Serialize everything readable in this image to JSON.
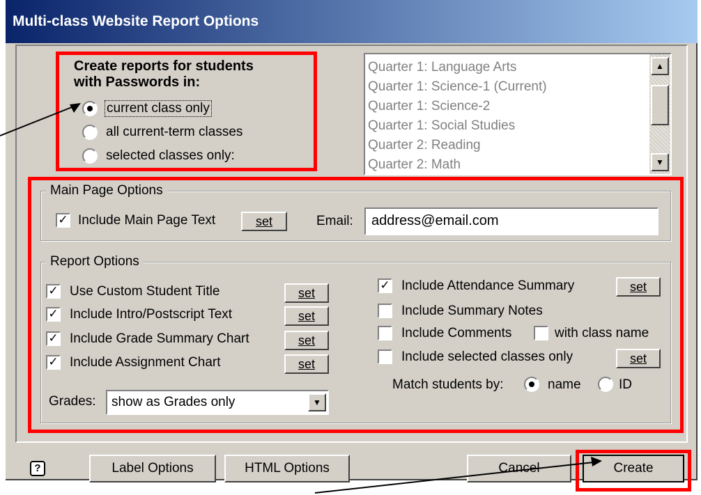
{
  "window": {
    "title": "Multi-class Website Report Options"
  },
  "students": {
    "heading_line1": "Create reports for students",
    "heading_line2": "with Passwords in:",
    "options": [
      "current class only",
      "all current-term classes",
      "selected classes only:"
    ],
    "selected_index": 0
  },
  "class_list": {
    "items": [
      "Quarter 1: Language Arts",
      "Quarter 1: Science-1 (Current)",
      "Quarter 1: Science-2",
      "Quarter 1: Social Studies",
      "Quarter 2: Reading",
      "Quarter 2: Math"
    ]
  },
  "main_page": {
    "legend": "Main Page Options",
    "include_text_label": "Include Main Page Text",
    "include_text_checked": true,
    "set_label": "set",
    "email_label": "Email:",
    "email_value": "address@email.com"
  },
  "report": {
    "legend": "Report Options",
    "left": [
      {
        "label": "Use Custom Student Title",
        "checked": true
      },
      {
        "label": "Include Intro/Postscript Text",
        "checked": true
      },
      {
        "label": "Include Grade Summary Chart",
        "checked": true
      },
      {
        "label": "Include Assignment Chart",
        "checked": true
      }
    ],
    "set_label": "set",
    "grades_label": "Grades:",
    "grades_value": "show as Grades only",
    "attendance_label": "Include Attendance Summary",
    "attendance_checked": true,
    "summary_notes_label": "Include Summary Notes",
    "summary_notes_checked": false,
    "comments_label": "Include Comments",
    "comments_checked": false,
    "with_class_name_label": "with class name",
    "with_class_name_checked": false,
    "selected_only_label": "Include selected classes only",
    "selected_only_checked": false,
    "match_label": "Match students by:",
    "match_name": "name",
    "match_id": "ID",
    "match_selected": "name"
  },
  "footer": {
    "help": "?",
    "label_options": "Label Options",
    "html_options": "HTML Options",
    "cancel": "Cancel",
    "create": "Create"
  },
  "colors": {
    "highlight": "#ff0000",
    "dialog_bg": "#d4d0c8",
    "title_start": "#0a246a",
    "title_end": "#a6caf0"
  }
}
